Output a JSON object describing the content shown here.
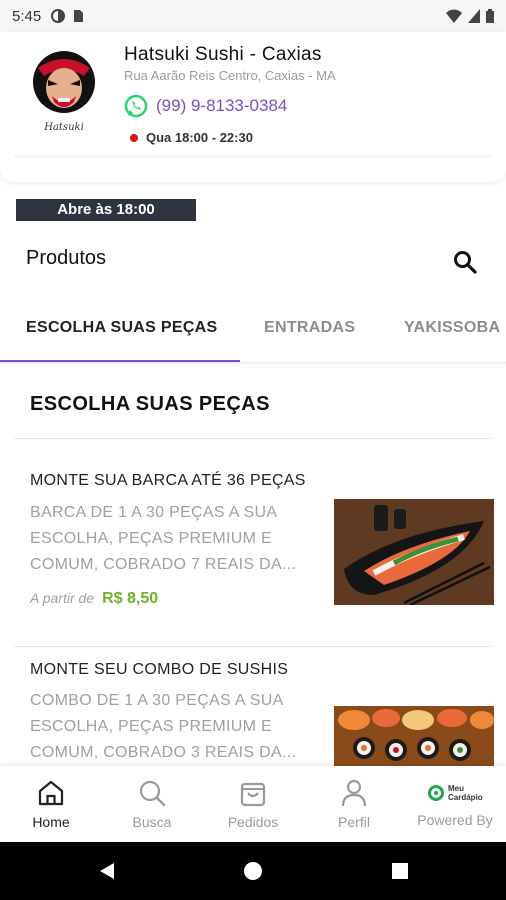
{
  "status_bar": {
    "time": "5:45"
  },
  "store": {
    "name": "Hatsuki Sushi - Caxias",
    "address": "Rua Aarão Reis Centro, Caxias - MA",
    "phone": "(99) 9-8133-0384",
    "hours": "Qua 18:00 - 22:30",
    "logo_text": "Hatsuki"
  },
  "open_badge": "Abre às 18:00",
  "products_title": "Produtos",
  "tabs": [
    "ESCOLHA SUAS PEÇAS",
    "ENTRADAS",
    "YAKISSOBA"
  ],
  "section": {
    "title": "ESCOLHA SUAS PEÇAS"
  },
  "products": [
    {
      "name": "MONTE SUA BARCA ATÉ 36 PEÇAS",
      "description": "BARCA DE 1 A 30 PEÇAS A SUA ESCOLHA, PEÇAS PREMIUM E COMUM, COBRADO 7 REAIS DA...",
      "price_prefix": "A partir de",
      "price": "R$ 8,50"
    },
    {
      "name": "MONTE SEU COMBO DE SUSHIS",
      "description": "COMBO DE 1 A 30 PEÇAS A SUA ESCOLHA, PEÇAS PREMIUM E COMUM, COBRADO 3 REAIS DA..."
    }
  ],
  "bottom_nav": {
    "items": [
      {
        "label": "Home",
        "icon": "home-icon"
      },
      {
        "label": "Busca",
        "icon": "search-icon"
      },
      {
        "label": "Pedidos",
        "icon": "shopping-bag-icon"
      },
      {
        "label": "Perfil",
        "icon": "user-icon"
      }
    ],
    "powered_by": "Powered By",
    "powered_logo_text": "Meu Cardápio"
  },
  "colors": {
    "accent": "#7b4fc9",
    "price_green": "#6fb12a",
    "whatsapp_green": "#25d366",
    "status_red": "#e10f0f",
    "badge_bg": "#2d3440"
  }
}
